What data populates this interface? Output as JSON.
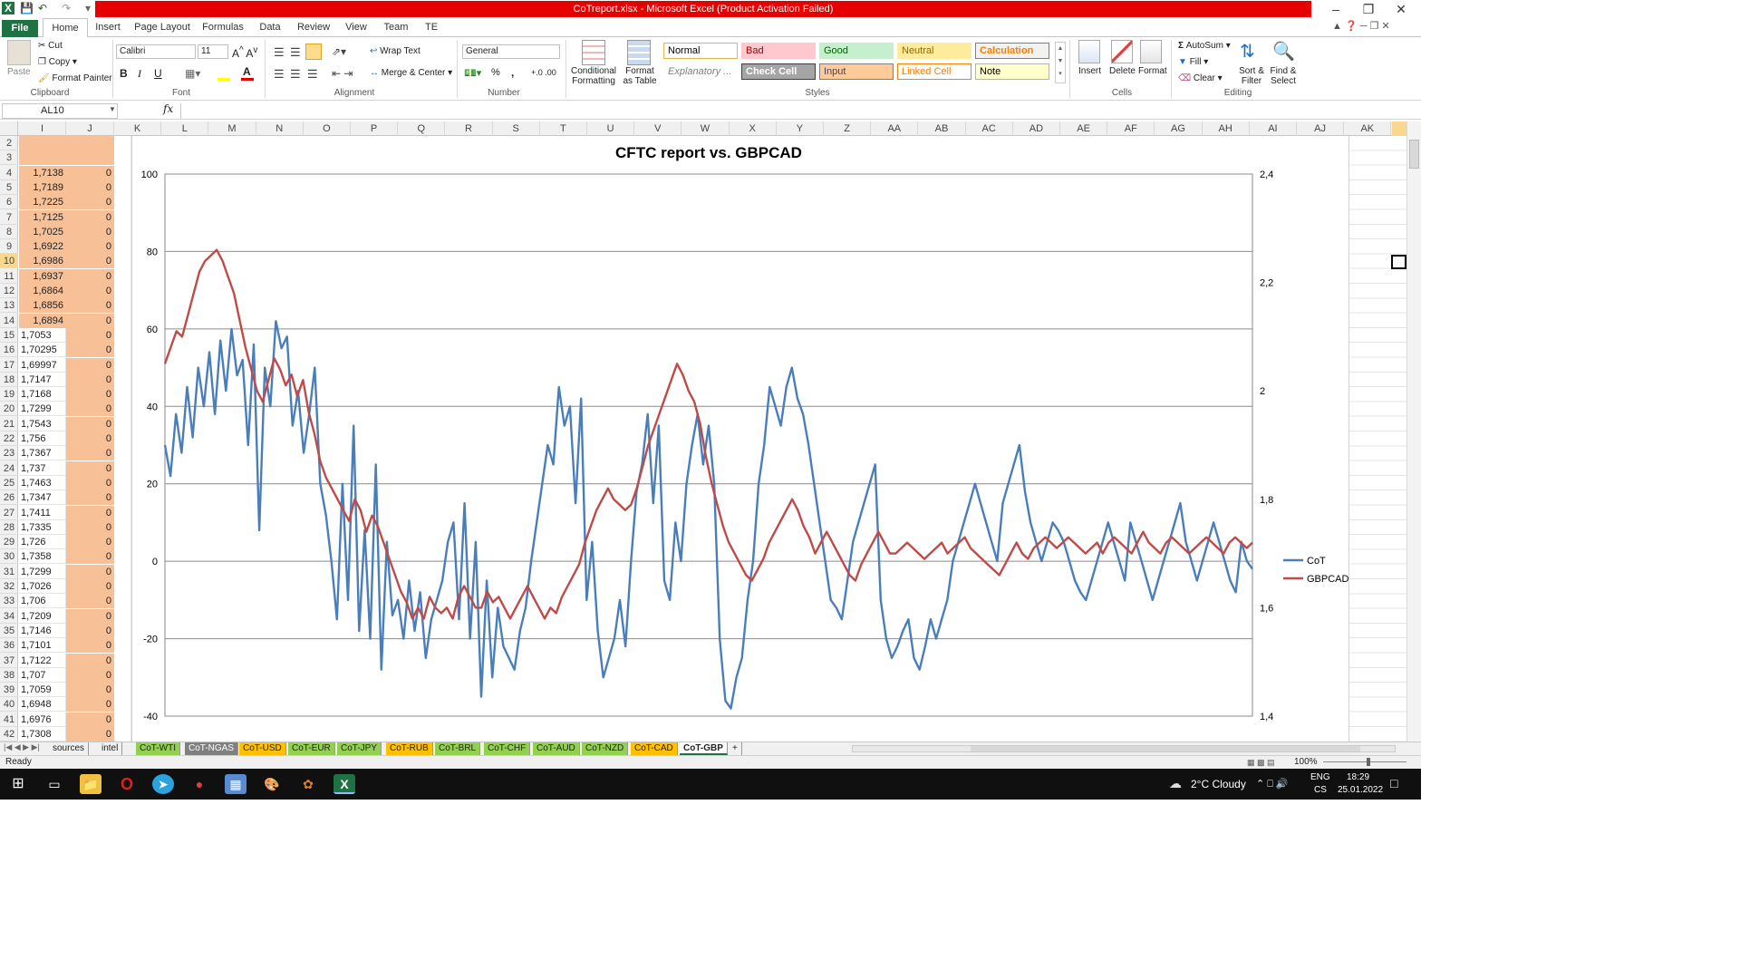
{
  "window": {
    "title": "CoTreport.xlsx  -  Microsoft Excel (Product Activation Failed)"
  },
  "ribbon_tabs": [
    "Insert",
    "Page Layout",
    "Formulas",
    "Data",
    "Review",
    "View",
    "Team",
    "TE"
  ],
  "file_tab": "File",
  "active_tab": "Home",
  "clipboard": {
    "paste": "Paste",
    "cut": "Cut",
    "copy": "Copy",
    "format_painter": "Format Painter",
    "label": "Clipboard"
  },
  "font": {
    "name": "Calibri",
    "size": "11",
    "label": "Font",
    "bold": "B",
    "italic": "I",
    "underline": "U"
  },
  "alignment": {
    "wrap_text": "Wrap Text",
    "merge_center": "Merge & Center",
    "label": "Alignment"
  },
  "number": {
    "format": "General",
    "label": "Number",
    "percent": "%",
    "comma": ","
  },
  "styles": {
    "conditional": "Conditional Formatting",
    "format_table": "Format as Table",
    "label": "Styles",
    "cells": [
      {
        "name": "Normal",
        "bg": "#ffffff",
        "fg": "#000000",
        "border": "#e0b44b"
      },
      {
        "name": "Bad",
        "bg": "#ffc7ce",
        "fg": "#9c0006",
        "border": "#ffc7ce"
      },
      {
        "name": "Good",
        "bg": "#c6efce",
        "fg": "#006100",
        "border": "#c6efce"
      },
      {
        "name": "Neutral",
        "bg": "#ffeb9c",
        "fg": "#9c6500",
        "border": "#ffeb9c"
      },
      {
        "name": "Calculation",
        "bg": "#f2f2f2",
        "fg": "#fa7d00",
        "border": "#7f7f7f"
      },
      {
        "name": "Explanatory ...",
        "bg": "#ffffff",
        "fg": "#7f7f7f",
        "border": "#ffffff"
      },
      {
        "name": "Check Cell",
        "bg": "#a5a5a5",
        "fg": "#ffffff",
        "border": "#3f3f3f"
      },
      {
        "name": "Input",
        "bg": "#ffcc99",
        "fg": "#3f3f76",
        "border": "#7f7f7f"
      },
      {
        "name": "Linked Cell",
        "bg": "#ffffff",
        "fg": "#fa7d00",
        "border": "#ff8001"
      },
      {
        "name": "Note",
        "bg": "#ffffcc",
        "fg": "#000000",
        "border": "#b2b2b2"
      }
    ]
  },
  "cells_group": {
    "insert": "Insert",
    "delete": "Delete",
    "format": "Format",
    "label": "Cells"
  },
  "editing": {
    "autosum": "AutoSum",
    "fill": "Fill",
    "clear": "Clear",
    "sort": "Sort & Filter",
    "find": "Find & Select",
    "label": "Editing"
  },
  "formula_bar": {
    "name_box": "AL10",
    "fx": "fx",
    "value": ""
  },
  "columns": [
    "I",
    "J",
    "K",
    "L",
    "M",
    "N",
    "O",
    "P",
    "Q",
    "R",
    "S",
    "T",
    "U",
    "V",
    "W",
    "X",
    "Y",
    "Z",
    "AA",
    "AB",
    "AC",
    "AD",
    "AE",
    "AF",
    "AG",
    "AH",
    "AI",
    "AJ",
    "AK"
  ],
  "rows": [
    {
      "n": "2",
      "i": "",
      "j": ""
    },
    {
      "n": "3",
      "i": "",
      "j": ""
    },
    {
      "n": "4",
      "i": "1,7138",
      "j": "0"
    },
    {
      "n": "5",
      "i": "1,7189",
      "j": "0"
    },
    {
      "n": "6",
      "i": "1,7225",
      "j": "0"
    },
    {
      "n": "7",
      "i": "1,7125",
      "j": "0"
    },
    {
      "n": "8",
      "i": "1,7025",
      "j": "0"
    },
    {
      "n": "9",
      "i": "1,6922",
      "j": "0"
    },
    {
      "n": "10",
      "i": "1,6986",
      "j": "0"
    },
    {
      "n": "11",
      "i": "1,6937",
      "j": "0"
    },
    {
      "n": "12",
      "i": "1,6864",
      "j": "0"
    },
    {
      "n": "13",
      "i": "1,6856",
      "j": "0"
    },
    {
      "n": "14",
      "i": "1,6894",
      "j": "0"
    },
    {
      "n": "15",
      "i": "1,7053",
      "j": "0"
    },
    {
      "n": "16",
      "i": "1,70295",
      "j": "0"
    },
    {
      "n": "17",
      "i": "1,69997",
      "j": "0"
    },
    {
      "n": "18",
      "i": "1,7147",
      "j": "0"
    },
    {
      "n": "19",
      "i": "1,7168",
      "j": "0"
    },
    {
      "n": "20",
      "i": "1,7299",
      "j": "0"
    },
    {
      "n": "21",
      "i": "1,7543",
      "j": "0"
    },
    {
      "n": "22",
      "i": "1,756",
      "j": "0"
    },
    {
      "n": "23",
      "i": "1,7367",
      "j": "0"
    },
    {
      "n": "24",
      "i": "1,737",
      "j": "0"
    },
    {
      "n": "25",
      "i": "1,7463",
      "j": "0"
    },
    {
      "n": "26",
      "i": "1,7347",
      "j": "0"
    },
    {
      "n": "27",
      "i": "1,7411",
      "j": "0"
    },
    {
      "n": "28",
      "i": "1,7335",
      "j": "0"
    },
    {
      "n": "29",
      "i": "1,726",
      "j": "0"
    },
    {
      "n": "30",
      "i": "1,7358",
      "j": "0"
    },
    {
      "n": "31",
      "i": "1,7299",
      "j": "0"
    },
    {
      "n": "32",
      "i": "1,7026",
      "j": "0"
    },
    {
      "n": "33",
      "i": "1,706",
      "j": "0"
    },
    {
      "n": "34",
      "i": "1,7209",
      "j": "0"
    },
    {
      "n": "35",
      "i": "1,7146",
      "j": "0"
    },
    {
      "n": "36",
      "i": "1,7101",
      "j": "0"
    },
    {
      "n": "37",
      "i": "1,7122",
      "j": "0"
    },
    {
      "n": "38",
      "i": "1,707",
      "j": "0"
    },
    {
      "n": "39",
      "i": "1,7059",
      "j": "0"
    },
    {
      "n": "40",
      "i": "1,6948",
      "j": "0"
    },
    {
      "n": "41",
      "i": "1,6976",
      "j": "0"
    },
    {
      "n": "42",
      "i": "1,7308",
      "j": "0"
    }
  ],
  "sheet_tabs": [
    {
      "name": "sources",
      "bg": "#f0f0f0"
    },
    {
      "name": "intel",
      "bg": "#f0f0f0"
    },
    {
      "name": "CoT-WTI",
      "bg": "#92d050"
    },
    {
      "name": "CoT-NGAS",
      "bg": "#808080"
    },
    {
      "name": "CoT-USD",
      "bg": "#ffc000"
    },
    {
      "name": "CoT-EUR",
      "bg": "#92d050"
    },
    {
      "name": "CoT-JPY",
      "bg": "#92d050"
    },
    {
      "name": "CoT-RUB",
      "bg": "#ffc000"
    },
    {
      "name": "CoT-BRL",
      "bg": "#92d050"
    },
    {
      "name": "CoT-CHF",
      "bg": "#92d050"
    },
    {
      "name": "CoT-AUD",
      "bg": "#92d050"
    },
    {
      "name": "CoT-NZD",
      "bg": "#92d050"
    },
    {
      "name": "CoT-CAD",
      "bg": "#ffc000"
    },
    {
      "name": "CoT-GBP",
      "bg": "#ffffff"
    }
  ],
  "status": {
    "ready": "Ready",
    "zoom": "100%"
  },
  "taskbar": {
    "weather": "2°C  Cloudy",
    "lang": "ENG",
    "lang2": "CS",
    "time": "18:29",
    "date": "25.01.2022"
  },
  "chart_data": {
    "type": "line",
    "title": "CFTC report vs.  GBPCAD",
    "y_left": {
      "min": -40,
      "max": 100,
      "ticks": [
        "100",
        "80",
        "60",
        "40",
        "20",
        "0",
        "-20",
        "-40"
      ]
    },
    "y_right": {
      "min": 1.4,
      "max": 2.4,
      "ticks": [
        "2,4",
        "2,2",
        "2",
        "1,8",
        "1,6",
        "1,4"
      ]
    },
    "grid": true,
    "legend_position": "right",
    "series": [
      {
        "name": "CoT",
        "axis": "left",
        "color": "#4a7ebb",
        "values": [
          30,
          22,
          38,
          28,
          45,
          32,
          50,
          40,
          54,
          38,
          57,
          44,
          60,
          48,
          52,
          30,
          56,
          8,
          50,
          40,
          62,
          55,
          58,
          35,
          44,
          28,
          38,
          50,
          20,
          12,
          0,
          -15,
          20,
          -10,
          35,
          -18,
          8,
          -20,
          25,
          -28,
          5,
          -14,
          -10,
          -20,
          -5,
          -18,
          -8,
          -25,
          -15,
          -10,
          -5,
          5,
          10,
          -15,
          15,
          -20,
          5,
          -35,
          -5,
          -30,
          -12,
          -22,
          -25,
          -28,
          -18,
          -12,
          0,
          10,
          20,
          30,
          25,
          45,
          35,
          40,
          15,
          42,
          -10,
          5,
          -18,
          -30,
          -25,
          -20,
          -10,
          -22,
          0,
          18,
          25,
          38,
          15,
          35,
          -5,
          -10,
          10,
          0,
          20,
          30,
          38,
          25,
          35,
          20,
          -20,
          -36,
          -38,
          -30,
          -25,
          -10,
          0,
          20,
          30,
          45,
          40,
          35,
          45,
          50,
          42,
          38,
          30,
          20,
          10,
          0,
          -10,
          -12,
          -15,
          -5,
          5,
          10,
          15,
          20,
          25,
          -10,
          -20,
          -25,
          -22,
          -18,
          -15,
          -25,
          -28,
          -22,
          -15,
          -20,
          -15,
          -10,
          0,
          5,
          10,
          15,
          20,
          15,
          10,
          5,
          0,
          15,
          20,
          25,
          30,
          18,
          10,
          5,
          0,
          5,
          10,
          8,
          5,
          0,
          -5,
          -8,
          -10,
          -5,
          0,
          5,
          10,
          5,
          0,
          -5,
          10,
          5,
          0,
          -5,
          -10,
          -5,
          0,
          5,
          10,
          15,
          5,
          0,
          -5,
          0,
          5,
          10,
          5,
          0,
          -5,
          -8,
          5,
          0,
          -2
        ]
      },
      {
        "name": "GBPCAD",
        "axis": "right",
        "color": "#be4b48",
        "values": [
          2.05,
          2.08,
          2.11,
          2.1,
          2.14,
          2.18,
          2.22,
          2.24,
          2.25,
          2.26,
          2.24,
          2.21,
          2.18,
          2.13,
          2.08,
          2.04,
          2.0,
          1.98,
          2.02,
          2.06,
          2.04,
          2.01,
          2.03,
          1.99,
          2.02,
          1.96,
          1.92,
          1.87,
          1.84,
          1.82,
          1.8,
          1.78,
          1.76,
          1.8,
          1.78,
          1.74,
          1.77,
          1.75,
          1.72,
          1.69,
          1.66,
          1.63,
          1.61,
          1.58,
          1.6,
          1.58,
          1.62,
          1.6,
          1.59,
          1.6,
          1.58,
          1.62,
          1.64,
          1.62,
          1.6,
          1.6,
          1.63,
          1.61,
          1.62,
          1.6,
          1.58,
          1.6,
          1.62,
          1.64,
          1.62,
          1.6,
          1.58,
          1.6,
          1.59,
          1.62,
          1.64,
          1.66,
          1.68,
          1.72,
          1.75,
          1.78,
          1.8,
          1.82,
          1.8,
          1.79,
          1.78,
          1.79,
          1.82,
          1.86,
          1.9,
          1.93,
          1.96,
          1.99,
          2.02,
          2.05,
          2.03,
          2.0,
          1.98,
          1.94,
          1.88,
          1.83,
          1.79,
          1.75,
          1.72,
          1.7,
          1.68,
          1.66,
          1.65,
          1.67,
          1.69,
          1.72,
          1.74,
          1.76,
          1.78,
          1.8,
          1.78,
          1.75,
          1.73,
          1.7,
          1.72,
          1.74,
          1.72,
          1.7,
          1.68,
          1.66,
          1.65,
          1.68,
          1.7,
          1.72,
          1.74,
          1.72,
          1.7,
          1.7,
          1.71,
          1.72,
          1.71,
          1.7,
          1.69,
          1.7,
          1.71,
          1.72,
          1.7,
          1.71,
          1.72,
          1.73,
          1.71,
          1.7,
          1.69,
          1.68,
          1.67,
          1.66,
          1.68,
          1.7,
          1.72,
          1.7,
          1.69,
          1.71,
          1.72,
          1.73,
          1.72,
          1.71,
          1.72,
          1.73,
          1.72,
          1.71,
          1.7,
          1.71,
          1.72,
          1.7,
          1.72,
          1.73,
          1.72,
          1.71,
          1.7,
          1.72,
          1.74,
          1.72,
          1.71,
          1.7,
          1.72,
          1.73,
          1.72,
          1.71,
          1.7,
          1.71,
          1.72,
          1.73,
          1.72,
          1.71,
          1.7,
          1.72,
          1.73,
          1.72,
          1.71,
          1.72
        ]
      }
    ]
  }
}
